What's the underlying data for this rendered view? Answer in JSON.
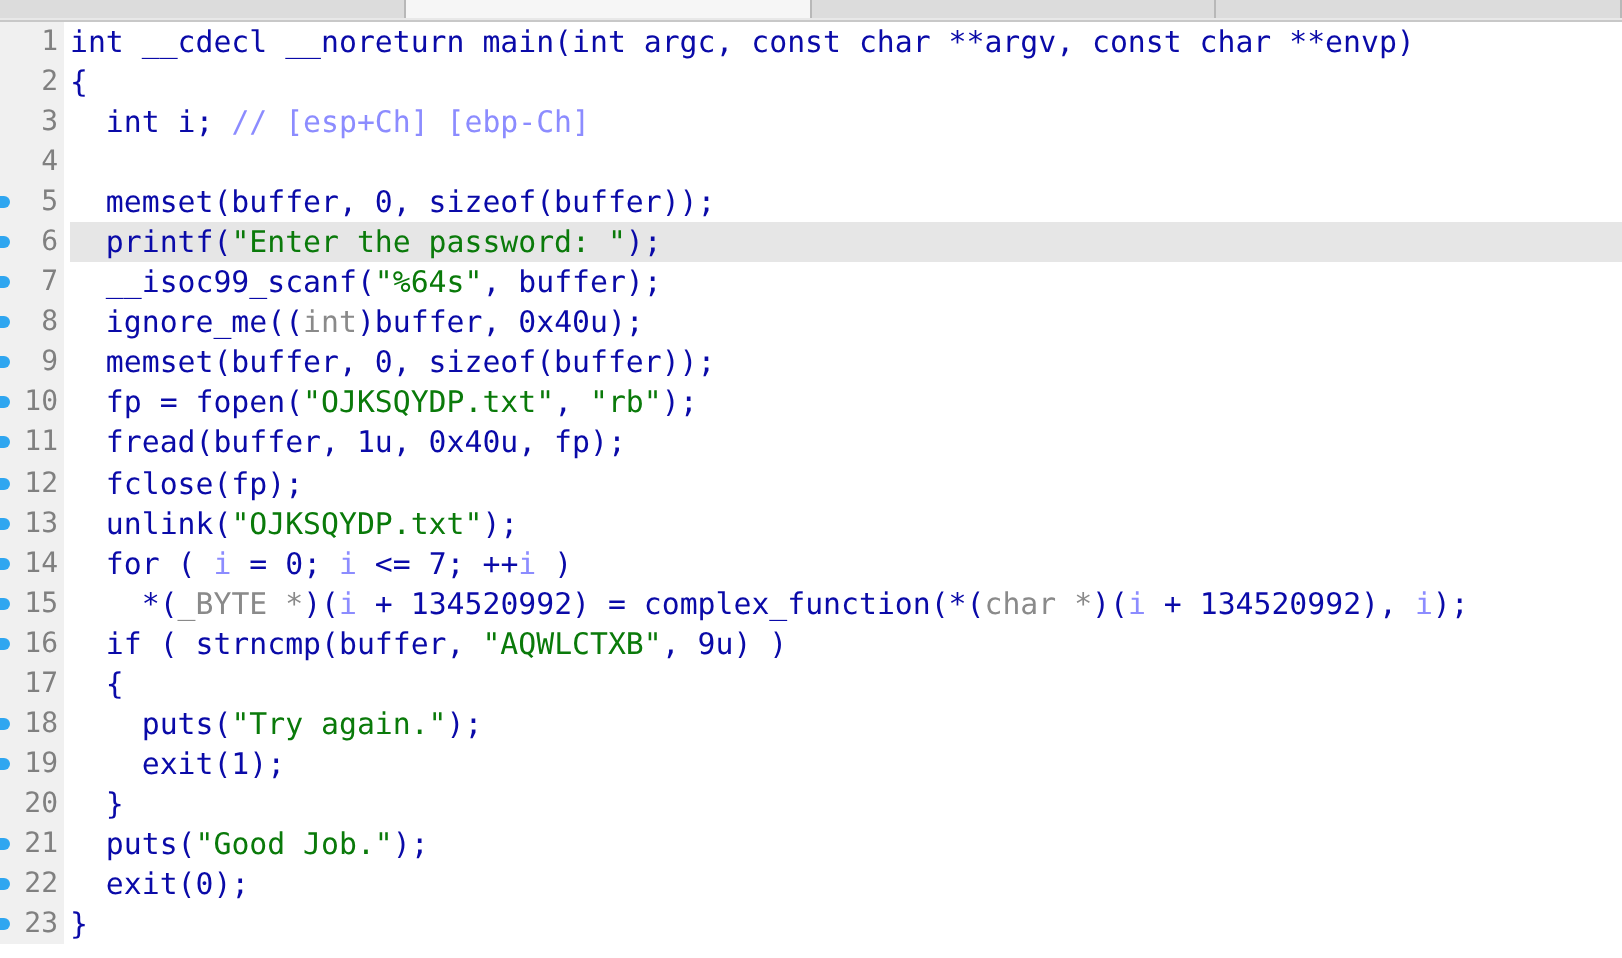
{
  "tabs": [
    {
      "selected": false
    },
    {
      "selected": true
    },
    {
      "selected": false
    },
    {
      "selected": false
    }
  ],
  "lines": [
    {
      "number": "1",
      "dot": false,
      "selected": false,
      "tokens": [
        {
          "text": "int __cdecl __noreturn main(int argc, const char **argv, const char **envp)",
          "kind": "code"
        }
      ]
    },
    {
      "number": "2",
      "dot": false,
      "selected": false,
      "tokens": [
        {
          "text": "{",
          "kind": "code"
        }
      ]
    },
    {
      "number": "3",
      "dot": false,
      "selected": false,
      "tokens": [
        {
          "text": "  int i; ",
          "kind": "code"
        },
        {
          "text": "// [esp+Ch] [ebp-Ch]",
          "kind": "cmt"
        }
      ]
    },
    {
      "number": "4",
      "dot": false,
      "selected": false
    },
    {
      "number": "5",
      "dot": true,
      "selected": false,
      "tokens": [
        {
          "text": "  memset(buffer, 0, sizeof(buffer));",
          "kind": "code"
        }
      ]
    },
    {
      "number": "6",
      "dot": true,
      "selected": true,
      "tokens": [
        {
          "text": "  printf(",
          "kind": "code"
        },
        {
          "text": "\"Enter the password: \"",
          "kind": "str"
        },
        {
          "text": ");",
          "kind": "code"
        }
      ]
    },
    {
      "number": "7",
      "dot": true,
      "selected": false,
      "tokens": [
        {
          "text": "  __isoc99_scanf(",
          "kind": "code"
        },
        {
          "text": "\"%64s\"",
          "kind": "str"
        },
        {
          "text": ", buffer);",
          "kind": "code"
        }
      ]
    },
    {
      "number": "8",
      "dot": true,
      "selected": false,
      "tokens": [
        {
          "text": "  ignore_me((",
          "kind": "code"
        },
        {
          "text": "int",
          "kind": "cast"
        },
        {
          "text": ")buffer, 0x40u);",
          "kind": "code"
        }
      ]
    },
    {
      "number": "9",
      "dot": true,
      "selected": false,
      "tokens": [
        {
          "text": "  memset(buffer, 0, sizeof(buffer));",
          "kind": "code"
        }
      ]
    },
    {
      "number": "10",
      "dot": true,
      "selected": false,
      "tokens": [
        {
          "text": "  fp = fopen(",
          "kind": "code"
        },
        {
          "text": "\"OJKSQYDP.txt\"",
          "kind": "str"
        },
        {
          "text": ", ",
          "kind": "code"
        },
        {
          "text": "\"rb\"",
          "kind": "str"
        },
        {
          "text": ");",
          "kind": "code"
        }
      ]
    },
    {
      "number": "11",
      "dot": true,
      "selected": false,
      "tokens": [
        {
          "text": "  fread(buffer, 1u, 0x40u, fp);",
          "kind": "code"
        }
      ]
    },
    {
      "number": "12",
      "dot": true,
      "selected": false,
      "tokens": [
        {
          "text": "  fclose(fp);",
          "kind": "code"
        }
      ]
    },
    {
      "number": "13",
      "dot": true,
      "selected": false,
      "tokens": [
        {
          "text": "  unlink(",
          "kind": "code"
        },
        {
          "text": "\"OJKSQYDP.txt\"",
          "kind": "str"
        },
        {
          "text": ");",
          "kind": "code"
        }
      ]
    },
    {
      "number": "14",
      "dot": true,
      "selected": false,
      "tokens": [
        {
          "text": "  for ( ",
          "kind": "code"
        },
        {
          "text": "i",
          "kind": "var"
        },
        {
          "text": " = 0; ",
          "kind": "code"
        },
        {
          "text": "i",
          "kind": "var"
        },
        {
          "text": " <= 7; ++",
          "kind": "code"
        },
        {
          "text": "i",
          "kind": "var"
        },
        {
          "text": " )",
          "kind": "code"
        }
      ]
    },
    {
      "number": "15",
      "dot": true,
      "selected": false,
      "tokens": [
        {
          "text": "    *(",
          "kind": "code"
        },
        {
          "text": "_BYTE *",
          "kind": "cast"
        },
        {
          "text": ")(",
          "kind": "code"
        },
        {
          "text": "i",
          "kind": "var"
        },
        {
          "text": " + 134520992) = complex_function(*(",
          "kind": "code"
        },
        {
          "text": "char *",
          "kind": "cast"
        },
        {
          "text": ")(",
          "kind": "code"
        },
        {
          "text": "i",
          "kind": "var"
        },
        {
          "text": " + 134520992), ",
          "kind": "code"
        },
        {
          "text": "i",
          "kind": "var"
        },
        {
          "text": ");",
          "kind": "code"
        }
      ]
    },
    {
      "number": "16",
      "dot": true,
      "selected": false,
      "tokens": [
        {
          "text": "  if ( strncmp(buffer, ",
          "kind": "code"
        },
        {
          "text": "\"AQWLCTXB\"",
          "kind": "str"
        },
        {
          "text": ", 9u) )",
          "kind": "code"
        }
      ]
    },
    {
      "number": "17",
      "dot": false,
      "selected": false,
      "tokens": [
        {
          "text": "  {",
          "kind": "code"
        }
      ]
    },
    {
      "number": "18",
      "dot": true,
      "selected": false,
      "tokens": [
        {
          "text": "    puts(",
          "kind": "code"
        },
        {
          "text": "\"Try again.\"",
          "kind": "str"
        },
        {
          "text": ");",
          "kind": "code"
        }
      ]
    },
    {
      "number": "19",
      "dot": true,
      "selected": false,
      "tokens": [
        {
          "text": "    exit(1);",
          "kind": "code"
        }
      ]
    },
    {
      "number": "20",
      "dot": false,
      "selected": false,
      "tokens": [
        {
          "text": "  }",
          "kind": "code"
        }
      ]
    },
    {
      "number": "21",
      "dot": true,
      "selected": false,
      "tokens": [
        {
          "text": "  puts(",
          "kind": "code"
        },
        {
          "text": "\"Good Job.\"",
          "kind": "str"
        },
        {
          "text": ");",
          "kind": "code"
        }
      ]
    },
    {
      "number": "22",
      "dot": true,
      "selected": false,
      "tokens": [
        {
          "text": "  exit(0);",
          "kind": "code"
        }
      ]
    },
    {
      "number": "23",
      "dot": true,
      "selected": false,
      "tokens": [
        {
          "text": "}",
          "kind": "code"
        }
      ]
    }
  ]
}
